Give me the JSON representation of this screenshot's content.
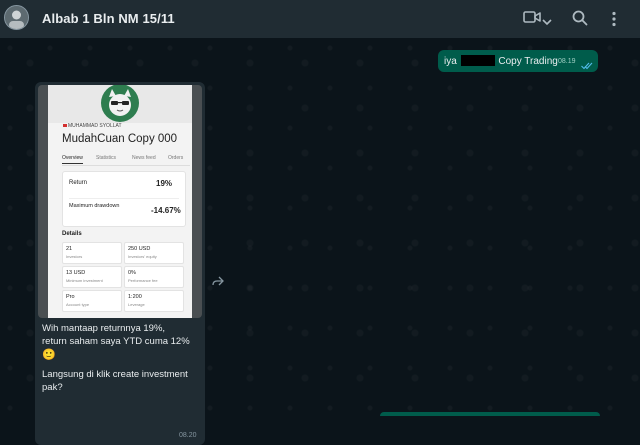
{
  "header": {
    "title": "Albab 1 Bln NM 15/11",
    "icons": [
      "avatar",
      "video-call-icon",
      "chevron-down-icon",
      "search-icon",
      "menu-icon"
    ]
  },
  "outgoing_message": {
    "text_before": "iya",
    "text_after": "Copy Trading",
    "time": "08.19",
    "status": "read"
  },
  "incoming_message": {
    "image": {
      "trader_name": "MUHAMMAD SYOLLAT",
      "account_name": "MudahCuan Copy 000",
      "tabs": [
        "Overview",
        "Statistics",
        "News feed",
        "Orders"
      ],
      "return_label": "Return",
      "return_value": "19%",
      "drawdown_label": "Maximum drawdown",
      "drawdown_value": "-14.67%",
      "details_label": "Details",
      "details": [
        {
          "value": "21",
          "label": "Investors"
        },
        {
          "value": "250 USD",
          "label": "Investors' equity"
        },
        {
          "value": "13 USD",
          "label": "Minimum investment"
        },
        {
          "value": "0%",
          "label": "Performance fee"
        },
        {
          "value": "Pro",
          "label": "Account type"
        },
        {
          "value": "1:200",
          "label": "Leverage"
        }
      ]
    },
    "text_line1": "Wih mantaap returnnya 19%,",
    "text_line2": "return saham saya YTD cuma 12%",
    "emoji": "🙂",
    "text_line3": "Langsung di klik create investment",
    "text_line4": "pak?",
    "time": "08.20"
  },
  "colors": {
    "background": "#0b141a",
    "header": "#202c33",
    "outgoing_bubble": "#005c4b",
    "incoming_bubble": "#202c33",
    "read_ticks": "#53bdeb"
  }
}
